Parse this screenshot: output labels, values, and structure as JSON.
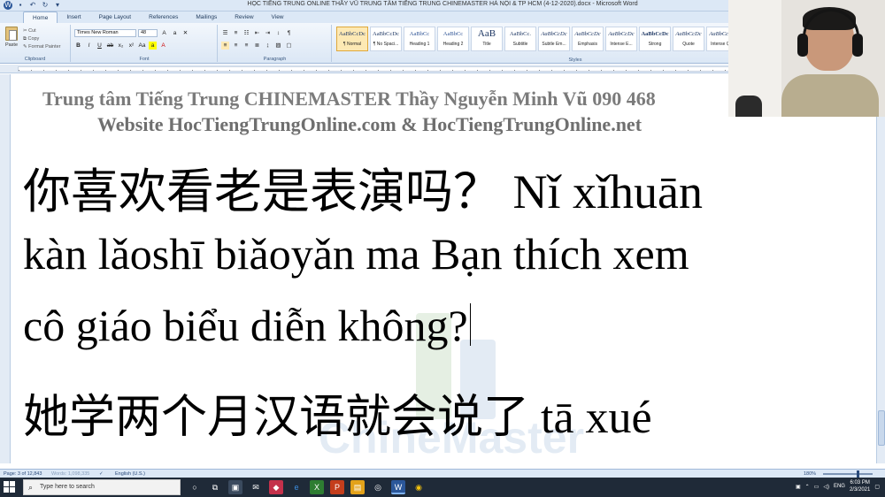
{
  "window": {
    "title": "HỌC TIẾNG TRUNG ONLINE THẦY VŨ TRUNG TÂM TIẾNG TRUNG CHINEMASTER HÀ NỘI & TP HCM (4-12-2020).docx - Microsoft Word"
  },
  "ribbon": {
    "tabs": [
      "Home",
      "Insert",
      "Page Layout",
      "References",
      "Mailings",
      "Review",
      "View"
    ],
    "active_tab": "Home",
    "clipboard": {
      "paste": "Paste",
      "cut": "Cut",
      "copy": "Copy",
      "format_painter": "Format Painter",
      "label": "Clipboard"
    },
    "font": {
      "name": "Times New Roman",
      "size": "48",
      "label": "Font"
    },
    "paragraph_label": "Paragraph",
    "styles_label": "Styles",
    "styles": [
      {
        "sample": "AaBbCcDc",
        "name": "¶ Normal",
        "selected": true
      },
      {
        "sample": "AaBbCcDc",
        "name": "¶ No Spaci...",
        "selected": false
      },
      {
        "sample": "AaBbCc",
        "name": "Heading 1",
        "selected": false
      },
      {
        "sample": "AaBbCc",
        "name": "Heading 2",
        "selected": false
      },
      {
        "sample": "AaB",
        "name": "Title",
        "selected": false
      },
      {
        "sample": "AaBbCc.",
        "name": "Subtitle",
        "selected": false
      },
      {
        "sample": "AaBbCcDc",
        "name": "Subtle Em...",
        "selected": false
      },
      {
        "sample": "AaBbCcDc",
        "name": "Emphasis",
        "selected": false
      },
      {
        "sample": "AaBbCcDc",
        "name": "Intense E...",
        "selected": false
      },
      {
        "sample": "AaBbCcDc",
        "name": "Strong",
        "selected": false
      },
      {
        "sample": "AaBbCcDc",
        "name": "Quote",
        "selected": false
      },
      {
        "sample": "AaBbCcDc",
        "name": "Intense Q...",
        "selected": false
      }
    ]
  },
  "document": {
    "header_line1": "Trung tâm Tiếng Trung CHINEMASTER Thầy Nguyễn Minh Vũ 090 468",
    "header_line2": "Website HocTiengTrungOnline.com & HocTiengTrungOnline.net",
    "line1": "你喜欢看老是表演吗？  Nǐ xǐhuān",
    "line2": "kàn lǎoshī biǎoyǎn ma Bạn thích xem",
    "line3": "cô giáo biểu diễn không?",
    "line4": "她学两个月汉语就会说了 tā xué",
    "watermark_text": "ChineMaster"
  },
  "statusbar": {
    "page": "Page: 3 of 12,843",
    "words": "Words: 1,098,335",
    "language": "English (U.S.)",
    "zoom": "180%"
  },
  "taskbar": {
    "search_placeholder": "Type here to search",
    "language": "ENG",
    "time": "6:03 PM",
    "date": "2/3/2021"
  }
}
